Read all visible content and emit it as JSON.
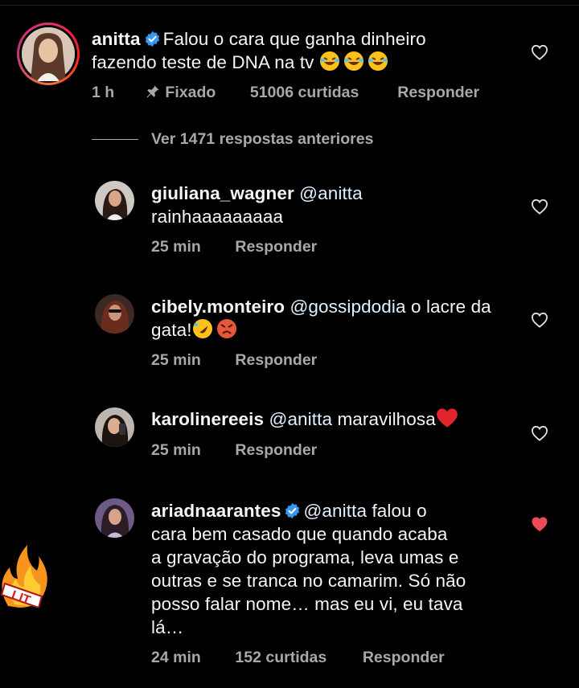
{
  "main_comment": {
    "username": "anitta",
    "verified": true,
    "text": "Falou o cara que ganha dinheiro fazendo teste de DNA na tv",
    "emojis": "😂😂😂",
    "time": "1 h",
    "pinned_label": "Fixado",
    "likes": "51006 curtidas",
    "reply_label": "Responder"
  },
  "view_replies": "Ver 1471 respostas anteriores",
  "replies": [
    {
      "username": "giuliana_wagner",
      "mention": "@anitta",
      "text": "rainhaaaaaaaaa",
      "time": "25 min",
      "reply_label": "Responder",
      "liked": false
    },
    {
      "username": "cibely.monteiro",
      "mention": "@gossipdodia",
      "text": "o lacre da gata!",
      "emojis": "🤣😡",
      "time": "25 min",
      "reply_label": "Responder",
      "liked": false
    },
    {
      "username": "karolinereeis",
      "mention": "@anitta",
      "text": "maravilhosa",
      "emojis": "❤",
      "time": "25 min",
      "reply_label": "Responder",
      "liked": false
    },
    {
      "username": "ariadnaarantes",
      "verified": true,
      "mention": "@anitta",
      "text_lines": [
        "falou o",
        "cara bem casado que quando acaba",
        "a gravação do programa, leva umas e",
        "outras e se tranca no camarim. Só não",
        "posso falar nome… mas eu vi, eu tava",
        "lá…"
      ],
      "time": "24 min",
      "likes": "152 curtidas",
      "reply_label": "Responder",
      "liked": true
    }
  ],
  "sticker": {
    "text": "LIT",
    "icon": "fire-icon"
  },
  "colors": {
    "background": "#000000",
    "meta": "#a8a8a8",
    "verified": "#3897f0",
    "liked_heart": "#ed4956"
  }
}
